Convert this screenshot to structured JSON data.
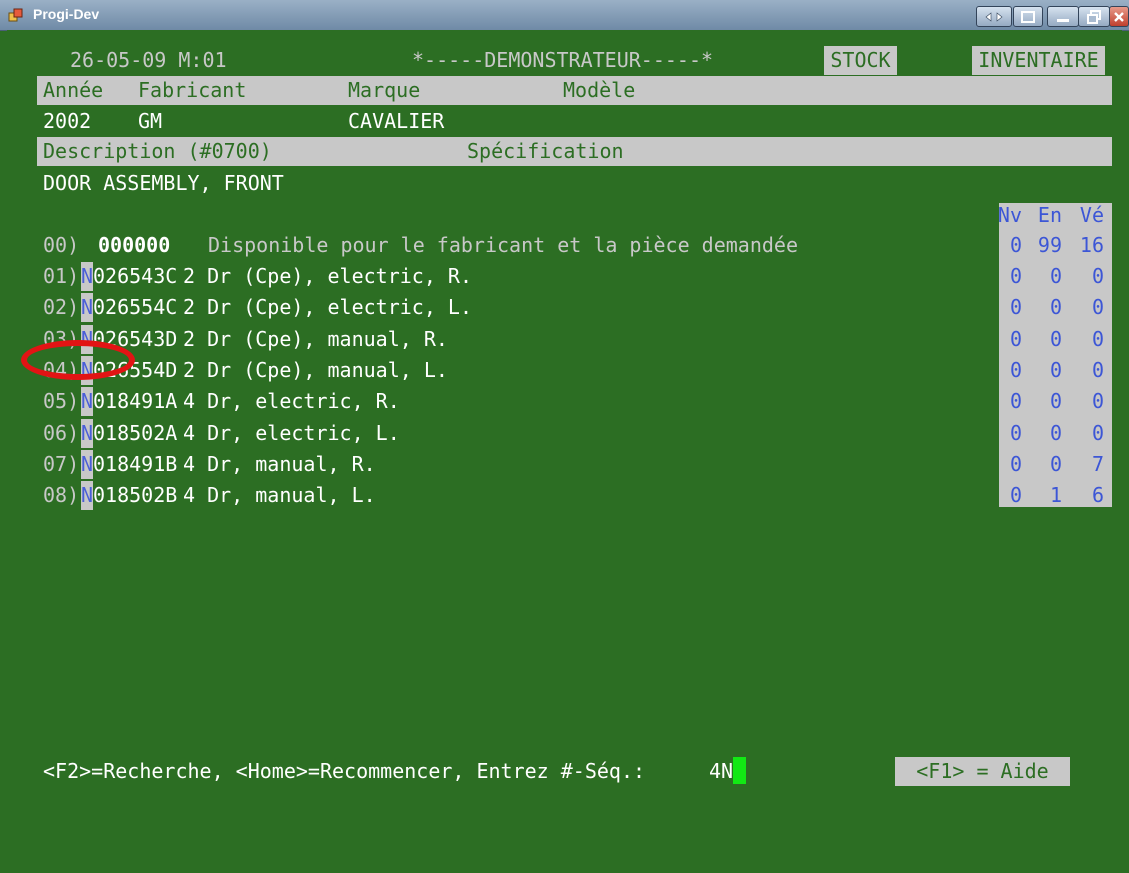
{
  "window": {
    "title": "Progi-Dev"
  },
  "header": {
    "date_mode": "26-05-09 M:01",
    "mode_banner": "*-----DEMONSTRATEUR-----*",
    "stock_label": "STOCK",
    "inventory_label": "INVENTAIRE"
  },
  "vehicle_header": {
    "year": "Année",
    "manufacturer": "Fabricant",
    "make": "Marque",
    "model": "Modèle"
  },
  "vehicle": {
    "year": "2002",
    "manufacturer": "GM",
    "make": "CAVALIER",
    "model": ""
  },
  "desc_header": {
    "description": "Description (#0700)",
    "specification": "Spécification"
  },
  "part": {
    "description": "DOOR ASSEMBLY, FRONT"
  },
  "inventory_header": {
    "nv": "Nv",
    "en": "En",
    "ve": "Vé"
  },
  "default_row": {
    "seq": "00)",
    "code": "000000",
    "text": "Disponible pour le fabricant et la pièce demandée",
    "nv": "0",
    "en": "99",
    "ve": "16"
  },
  "parts": [
    {
      "seq": "01)",
      "flag": "N",
      "code": "026543C",
      "desc": "2 Dr (Cpe), electric, R.",
      "nv": "0",
      "en": "0",
      "ve": "0"
    },
    {
      "seq": "02)",
      "flag": "N",
      "code": "026554C",
      "desc": "2 Dr (Cpe), electric, L.",
      "nv": "0",
      "en": "0",
      "ve": "0"
    },
    {
      "seq": "03)",
      "flag": "N",
      "code": "026543D",
      "desc": "2 Dr (Cpe), manual, R.",
      "nv": "0",
      "en": "0",
      "ve": "0"
    },
    {
      "seq": "04)",
      "flag": "N",
      "code": "026554D",
      "desc": "2 Dr (Cpe), manual, L.",
      "nv": "0",
      "en": "0",
      "ve": "0"
    },
    {
      "seq": "05)",
      "flag": "N",
      "code": "018491A",
      "desc": "4 Dr, electric, R.",
      "nv": "0",
      "en": "0",
      "ve": "0"
    },
    {
      "seq": "06)",
      "flag": "N",
      "code": "018502A",
      "desc": "4 Dr, electric, L.",
      "nv": "0",
      "en": "0",
      "ve": "0"
    },
    {
      "seq": "07)",
      "flag": "N",
      "code": "018491B",
      "desc": "4 Dr, manual, R.",
      "nv": "0",
      "en": "0",
      "ve": "7"
    },
    {
      "seq": "08)",
      "flag": "N",
      "code": "018502B",
      "desc": "4 Dr, manual, L.",
      "nv": "0",
      "en": "1",
      "ve": "6"
    }
  ],
  "footer": {
    "prompt": "<F2>=Recherche, <Home>=Recommencer, Entrez #-Séq.:",
    "input_value": "4N",
    "help": "<F1> = Aide"
  },
  "colors": {
    "terminal_bg": "#2c6e23",
    "bar_bg": "#c8c8c8",
    "inventory_text": "#3c56d6",
    "cursor": "#12e814",
    "annotation": "#e21414"
  }
}
